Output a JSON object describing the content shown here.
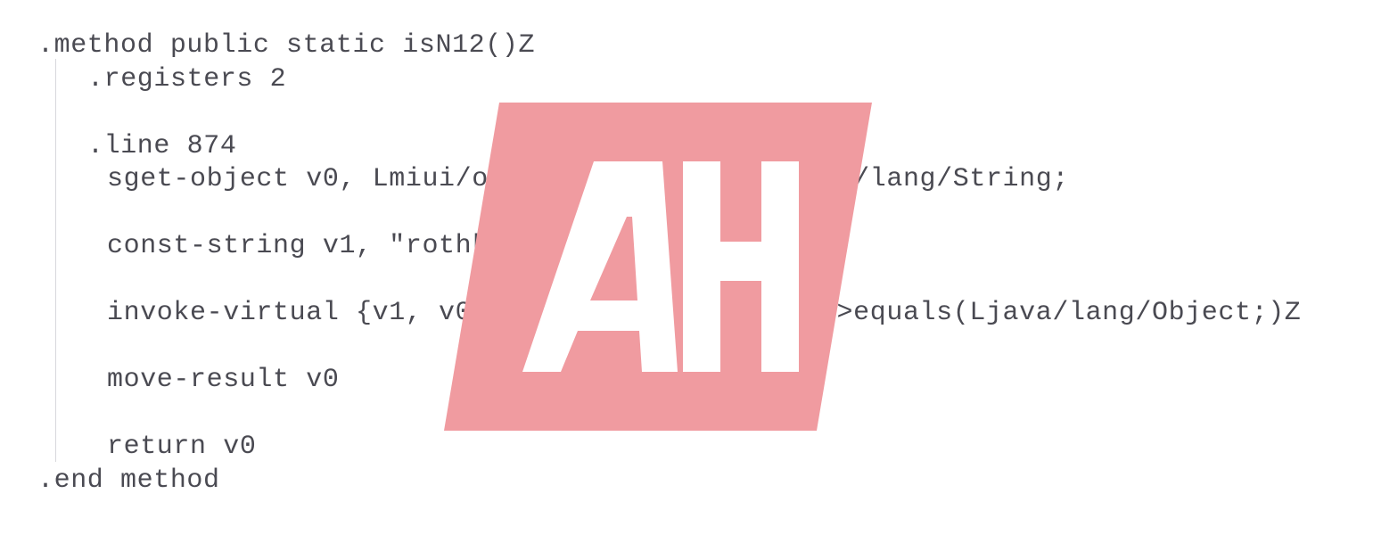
{
  "document": {
    "type": "smali-bytecode-listing",
    "background_color": "#ffffff",
    "text_color": "#4a4a52",
    "indent_guide_color": "#d8d8dc"
  },
  "code": {
    "language": "smali",
    "lines": [
      {
        "text": ".method public static isN12()Z",
        "indent": 0
      },
      {
        "text": ".registers 2",
        "indent": 1
      },
      {
        "text": "",
        "indent": 1
      },
      {
        "text": ".line 874",
        "indent": 1
      },
      {
        "text": "sget-object v0, Lmiui/os/Build;->DEVICE:Ljava/lang/String;",
        "indent": 2
      },
      {
        "text": "",
        "indent": 2
      },
      {
        "text": "const-string v1, \"rothko\"",
        "indent": 2
      },
      {
        "text": "",
        "indent": 2
      },
      {
        "text": "invoke-virtual {v1, v0}, Ljava/lang/String;->equals(Ljava/lang/Object;)Z",
        "indent": 2
      },
      {
        "text": "",
        "indent": 2
      },
      {
        "text": "move-result v0",
        "indent": 2
      },
      {
        "text": "",
        "indent": 2
      },
      {
        "text": "return v0",
        "indent": 2
      },
      {
        "text": ".end method",
        "indent": 0
      }
    ]
  },
  "watermark": {
    "label": "AH",
    "shape": "skewed-parallelogram",
    "fill_color": "#f09ba0",
    "letter_color": "#ffffff"
  }
}
